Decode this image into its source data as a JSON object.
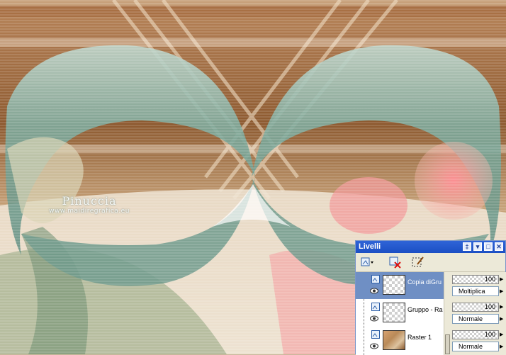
{
  "watermark": {
    "signature": "Pinuccia",
    "url": "www.maidiregrafica.eu"
  },
  "layers_panel": {
    "title": "Livelli",
    "title_buttons": [
      "pin-icon",
      "menu-icon",
      "maximize-icon",
      "close-icon"
    ],
    "toolbar": [
      "new-layer-icon",
      "delete-layer-icon",
      "edit-selection-icon"
    ],
    "layers": [
      {
        "name": "Copia diGru",
        "opacity": "100",
        "blend": "Moltiplica",
        "selected": true,
        "thumb": "transparent"
      },
      {
        "name": "Gruppo - Ra",
        "opacity": "100",
        "blend": "Normale",
        "selected": false,
        "thumb": "transparent"
      },
      {
        "name": "Raster 1",
        "opacity": "100",
        "blend": "Normale",
        "selected": false,
        "thumb": "raster"
      }
    ]
  },
  "colors": {
    "teal": "#7aa79a",
    "brown": "#8a5a2e",
    "pink": "#f09a9a",
    "panel_bg": "#ece9d8",
    "title_blue": "#2459d1",
    "selected": "#6f8fc4"
  }
}
